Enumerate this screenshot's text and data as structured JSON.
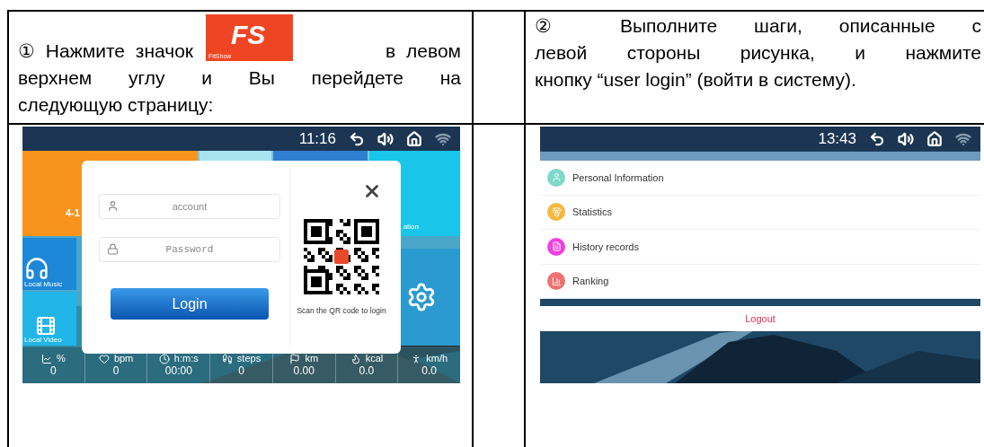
{
  "step1": {
    "text_before": "① Нажмите значок",
    "logo": {
      "mark": "FS",
      "caption": "FitShow"
    },
    "text_after": "в левом",
    "lines": [
      "верхнем углу и Вы перейдете на",
      "следующую страницу:"
    ]
  },
  "step2": {
    "lines": [
      "② Выполните шаги, описанные с",
      "левой стороны рисунка, и нажмите",
      "кнопку “user login” (войти в систему)."
    ]
  },
  "screen1": {
    "time": "11:16",
    "tiles": [
      {
        "label": "4-1"
      },
      {
        "label": "Local Music"
      },
      {
        "label": "Local Video"
      },
      {
        "label": "ation"
      }
    ],
    "login_dialog": {
      "account_placeholder": "account",
      "password_placeholder": "Password",
      "login_button": "Login",
      "qr_caption": "Scan the QR code to login"
    },
    "stats": [
      {
        "unit": "%",
        "value": "0"
      },
      {
        "unit": "bpm",
        "value": "0"
      },
      {
        "unit": "h:m:s",
        "value": "00:00"
      },
      {
        "unit": "steps",
        "value": "0"
      },
      {
        "unit": "km",
        "value": "0.00"
      },
      {
        "unit": "kcal",
        "value": "0.0"
      },
      {
        "unit": "km/h",
        "value": "0.0"
      }
    ]
  },
  "screen2": {
    "time": "13:43",
    "menu": [
      {
        "label": "Personal Information",
        "color": "#7dd9c9"
      },
      {
        "label": "Statistics",
        "color": "#f6b73c"
      },
      {
        "label": "History records",
        "color": "#f040e0"
      },
      {
        "label": "Ranking",
        "color": "#f07070"
      }
    ],
    "logout": "Logout"
  }
}
